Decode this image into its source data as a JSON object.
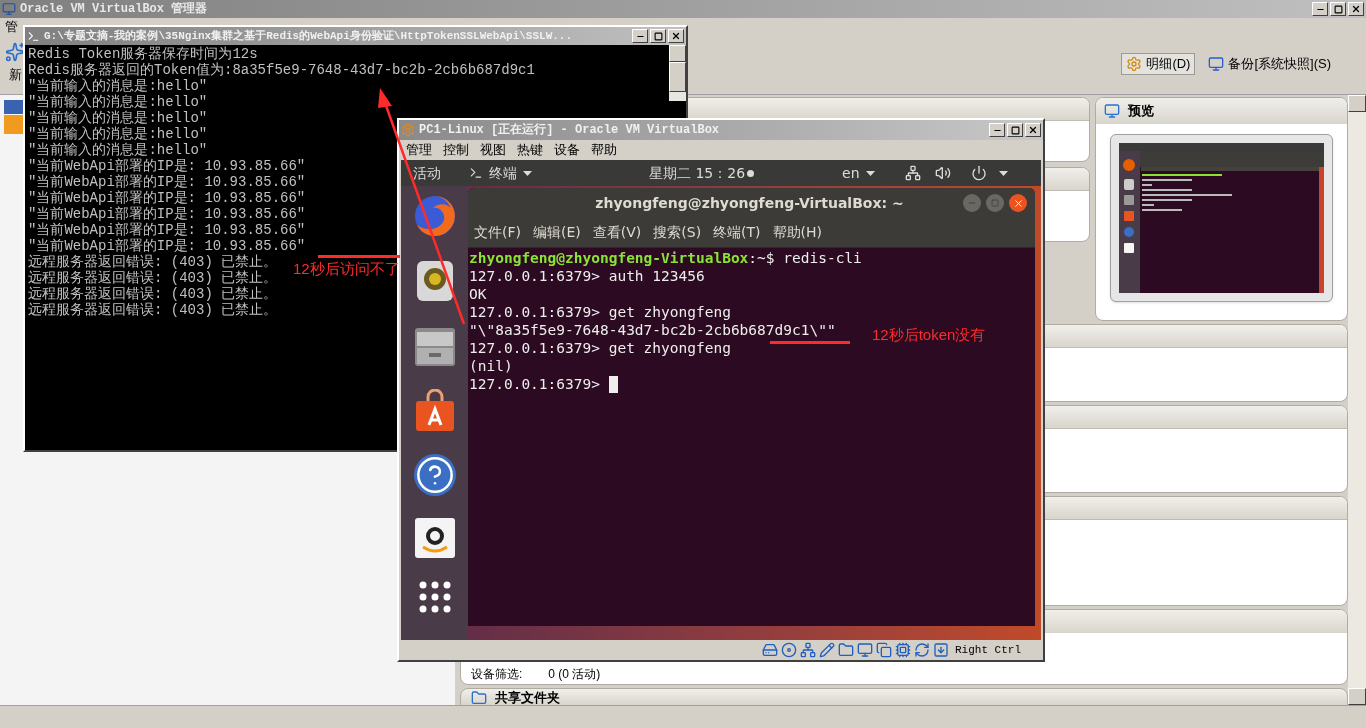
{
  "manager": {
    "title": "Oracle VM VirtualBox 管理器",
    "menu_item": "管",
    "toolbar_item": "新",
    "view_buttons": [
      {
        "label": "明细(D)",
        "selected": true
      },
      {
        "label": "备份[系统快照](S)",
        "selected": false
      }
    ],
    "preview_title": "预览",
    "usb_filter_label": "设备筛选:",
    "usb_filter_value": "0 (0 活动)",
    "shared_folders_title": "共享文件夹"
  },
  "console": {
    "title": "G:\\专题文摘-我的案例\\35Nginx集群之基于Redis的WebApi身份验证\\HttpTokenSSLWebApi\\SSLW...",
    "lines": [
      "Redis Token服务器保存时间为12s",
      "Redis服务器返回的Token值为:8a35f5e9-7648-43d7-bc2b-2cb6b687d9c1",
      "\"当前输入的消息是:hello\"",
      "\"当前输入的消息是:hello\"",
      "\"当前输入的消息是:hello\"",
      "\"当前输入的消息是:hello\"",
      "\"当前输入的消息是:hello\"",
      "\"当前WebApi部署的IP是: 10.93.85.66\"",
      "\"当前WebApi部署的IP是: 10.93.85.66\"",
      "\"当前WebApi部署的IP是: 10.93.85.66\"",
      "\"当前WebApi部署的IP是: 10.93.85.66\"",
      "\"当前WebApi部署的IP是: 10.93.85.66\"",
      "\"当前WebApi部署的IP是: 10.93.85.66\"",
      "远程服务器返回错误: (403) 已禁止。",
      "远程服务器返回错误: (403) 已禁止。",
      "远程服务器返回错误: (403) 已禁止。",
      "远程服务器返回错误: (403) 已禁止。"
    ]
  },
  "vm": {
    "title": "PC1-Linux [正在运行] - Oracle VM VirtualBox",
    "menu": [
      "管理",
      "控制",
      "视图",
      "热键",
      "设备",
      "帮助"
    ],
    "host_key": "Right Ctrl",
    "topbar": {
      "activities": "活动",
      "app": "终端",
      "clock": "星期二 15：26",
      "language": "en"
    },
    "terminal": {
      "title": "zhyongfeng@zhyongfeng-VirtualBox: ~",
      "menu": [
        "文件(F)",
        "编辑(E)",
        "查看(V)",
        "搜索(S)",
        "终端(T)",
        "帮助(H)"
      ],
      "lines": [
        {
          "kind": "user_prompt",
          "user": "zhyongfeng@zhyongfeng-VirtualBox",
          "rest": ":~$ redis-cli"
        },
        {
          "kind": "plain",
          "text": "127.0.0.1:6379> auth 123456"
        },
        {
          "kind": "plain",
          "text": "OK"
        },
        {
          "kind": "plain",
          "text": "127.0.0.1:6379> get zhyongfeng"
        },
        {
          "kind": "plain",
          "text": "\"\\\"8a35f5e9-7648-43d7-bc2b-2cb6b687d9c1\\\"\""
        },
        {
          "kind": "plain",
          "text": "127.0.0.1:6379> get zhyongfeng"
        },
        {
          "kind": "plain",
          "text": "(nil)"
        },
        {
          "kind": "cursor",
          "text": "127.0.0.1:6379>"
        }
      ]
    }
  },
  "annotations": [
    {
      "text": "12秒后访问不了"
    },
    {
      "text": "12秒后token没有"
    }
  ]
}
